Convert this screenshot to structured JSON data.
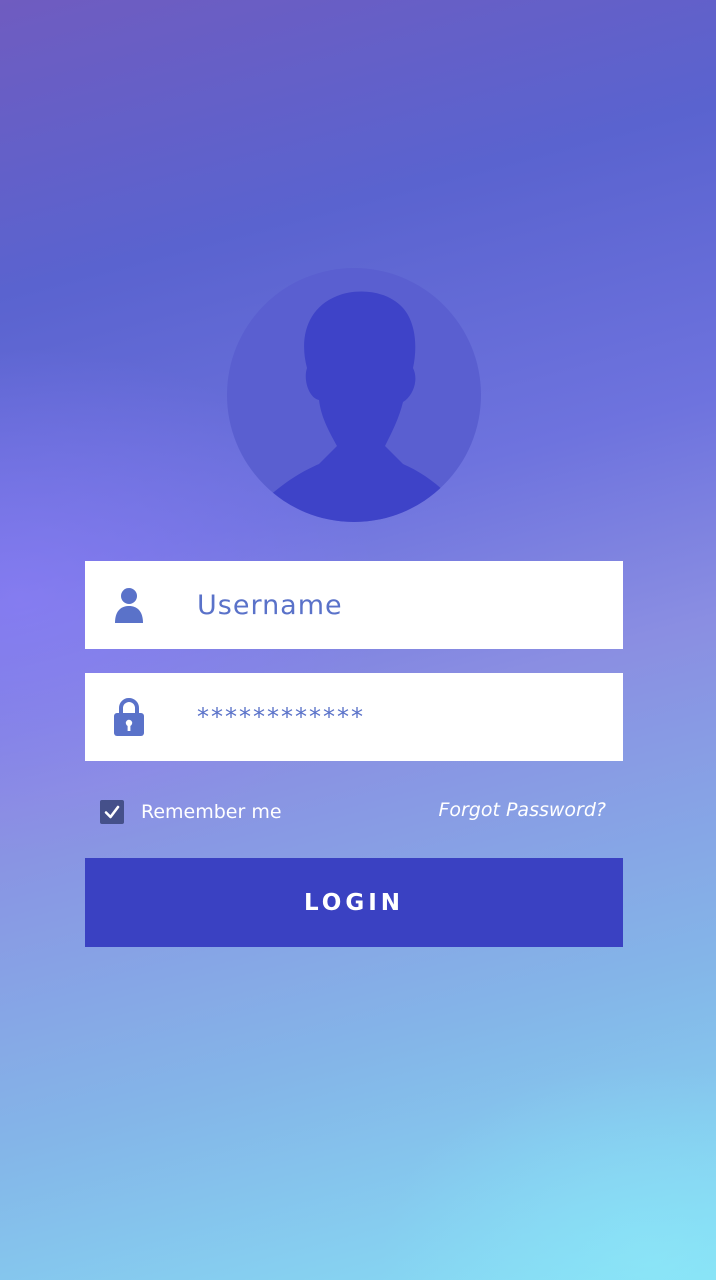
{
  "avatar": {
    "icon": "user-silhouette-icon"
  },
  "username_field": {
    "icon": "user-icon",
    "placeholder": "Username",
    "value": ""
  },
  "password_field": {
    "icon": "lock-icon",
    "value": "************"
  },
  "remember": {
    "label": "Remember me",
    "checked": true
  },
  "forgot_password": {
    "label": "Forgot Password?"
  },
  "login_button": {
    "label": "LOGIN"
  },
  "colors": {
    "accent": "#3a41c2",
    "input_text": "#5a72c9",
    "avatar_bg": "#5a5fd0",
    "silhouette": "#3b3fc4"
  }
}
